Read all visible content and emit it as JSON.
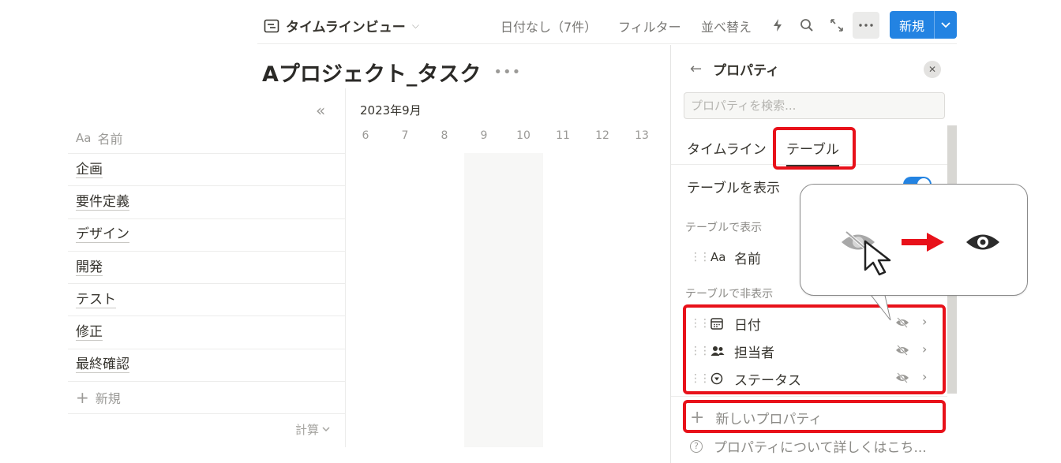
{
  "toolbar": {
    "view_name": "タイムラインビュー",
    "no_date": "日付なし（7件）",
    "filter": "フィルター",
    "sort": "並べ替え",
    "new_label": "新規"
  },
  "page": {
    "title": "Aプロジェクト_タスク"
  },
  "table": {
    "aa": "Aa",
    "name_header": "名前",
    "tasks": [
      "企画",
      "要件定義",
      "デザイン",
      "開発",
      "テスト",
      "修正",
      "最終確認"
    ],
    "add_new": "新規",
    "calc": "計算"
  },
  "timeline": {
    "month": "2023年9月",
    "days": [
      "6",
      "7",
      "8",
      "9",
      "10",
      "11",
      "12",
      "13"
    ]
  },
  "panel": {
    "title": "プロパティ",
    "search_placeholder": "プロパティを検索...",
    "tab_timeline": "タイムライン",
    "tab_table": "テーブル",
    "show_table": "テーブルを表示",
    "section_shown": "テーブルで表示",
    "section_hidden": "テーブルで非表示",
    "shown_props": [
      {
        "icon": "Aa",
        "label": "名前"
      }
    ],
    "hidden_props": [
      {
        "icon": "calendar-icon",
        "label": "日付"
      },
      {
        "icon": "people-icon",
        "label": "担当者"
      },
      {
        "icon": "status-icon",
        "label": "ステータス"
      }
    ],
    "new_property": "新しいプロパティ",
    "help": "プロパティについて詳しくはこち..."
  },
  "colors": {
    "accent": "#2383e2",
    "highlight": "#e8111a"
  }
}
